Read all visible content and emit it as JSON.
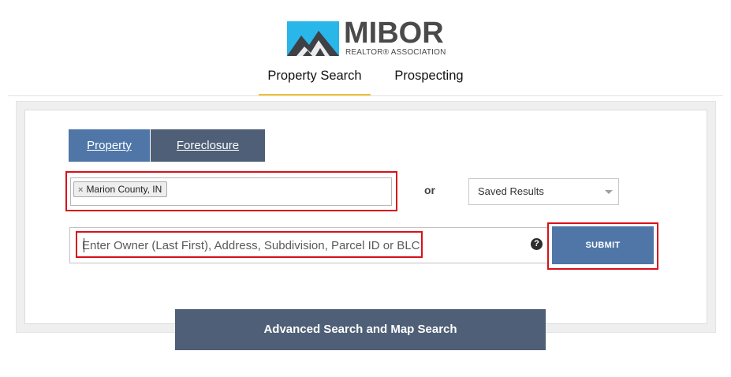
{
  "brand": {
    "name": "MIBOR",
    "tagline": "REALTOR® ASSOCIATION",
    "colors": {
      "sky": "#29b6e8",
      "mountain": "#3e4145",
      "text": "#4a4a4a"
    }
  },
  "top_nav": {
    "tabs": [
      {
        "label": "Property Search",
        "active": true
      },
      {
        "label": "Prospecting",
        "active": false
      }
    ],
    "active_color": "#f2c12e"
  },
  "search_tabs": [
    {
      "label": "Property",
      "active": true,
      "color": "#4f76a7"
    },
    {
      "label": "Foreclosure",
      "active": false,
      "color": "#4e5f77"
    }
  ],
  "location": {
    "selected": [
      {
        "label": "Marion County, IN",
        "remove_icon": "×"
      }
    ]
  },
  "or_label": "or",
  "saved_results": {
    "selected": "Saved Results",
    "icon": "chevron-down-icon"
  },
  "owner_search": {
    "placeholder": "Enter Owner (Last First), Address, Subdivision, Parcel ID or BLC#...",
    "value": "",
    "help_icon": "?"
  },
  "submit_label": "SUBMIT",
  "advanced_label": "Advanced Search and Map Search",
  "highlight_color": "#d9111a"
}
